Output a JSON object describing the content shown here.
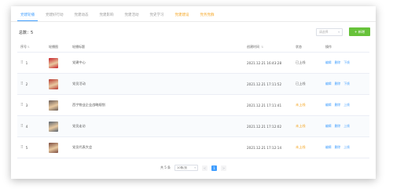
{
  "tabs": [
    {
      "label": "党建轮播",
      "state": "active"
    },
    {
      "label": "党建好行动",
      "state": "normal"
    },
    {
      "label": "党建动态",
      "state": "normal"
    },
    {
      "label": "党建影响",
      "state": "normal"
    },
    {
      "label": "党建活动",
      "state": "normal"
    },
    {
      "label": "党史学习",
      "state": "normal"
    },
    {
      "label": "党建建设",
      "state": "highlight"
    },
    {
      "label": "党务党群",
      "state": "highlight"
    }
  ],
  "toolbar": {
    "count_label": "总数：5",
    "filter_placeholder": "请选择",
    "add_label": "+ 新增"
  },
  "table": {
    "headers": {
      "index": "序号",
      "image": "轮播图",
      "title": "轮播标题",
      "time": "创建时间",
      "status": "状态",
      "ops": "操作"
    },
    "rows": [
      {
        "index": "1",
        "title": "党建中心",
        "time": "2021.12.21 16:43:28",
        "status": "已上线",
        "status_kind": "on",
        "ops": [
          "编辑",
          "删除",
          "下线"
        ],
        "thumb": "#c8202a"
      },
      {
        "index": "2",
        "title": "党员活动",
        "time": "2021.12.21 17:11:52",
        "status": "已上线",
        "status_kind": "on",
        "ops": [
          "编辑",
          "删除",
          "下线"
        ],
        "thumb": "#b83a33"
      },
      {
        "index": "3",
        "title": "西宁物业企业战略规划",
        "time": "2021.12.21 17:11:41",
        "status": "未上线",
        "status_kind": "off",
        "ops": [
          "编辑",
          "删除",
          "上线"
        ],
        "thumb": "#6b5e58"
      },
      {
        "index": "4",
        "title": "党员走访",
        "time": "2021.12.21 17:12:02",
        "status": "未上线",
        "status_kind": "off",
        "ops": [
          "编辑",
          "删除",
          "上线"
        ],
        "thumb": "#5a6470"
      },
      {
        "index": "5",
        "title": "党员代表大会",
        "time": "2021.12.21 17:12:14",
        "status": "未上线",
        "status_kind": "off",
        "ops": [
          "编辑",
          "删除",
          "上线"
        ],
        "thumb": "#7b4a3e"
      }
    ]
  },
  "pagination": {
    "total_label": "共 5 条",
    "page_size": "10条/页",
    "prev": "<",
    "current": "1",
    "next": ">"
  },
  "colors": {
    "accent": "#409eff",
    "add_button": "#67c23a",
    "offline_status": "#f5a623"
  }
}
